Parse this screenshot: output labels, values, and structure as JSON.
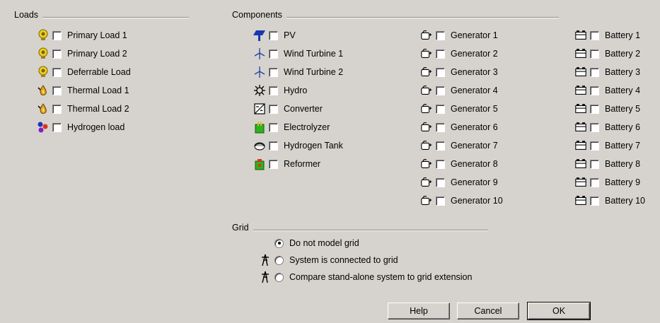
{
  "loads": {
    "title": "Loads",
    "items": [
      {
        "label": "Primary Load 1",
        "icon": "bulb-icon"
      },
      {
        "label": "Primary Load 2",
        "icon": "bulb-icon"
      },
      {
        "label": "Deferrable Load",
        "icon": "bulb-icon"
      },
      {
        "label": "Thermal Load 1",
        "icon": "flame-icon"
      },
      {
        "label": "Thermal Load 2",
        "icon": "flame-icon"
      },
      {
        "label": "Hydrogen load",
        "icon": "molecule-icon"
      }
    ]
  },
  "components": {
    "title": "Components",
    "col1": [
      {
        "label": "PV",
        "icon": "solar-panel-icon"
      },
      {
        "label": "Wind Turbine 1",
        "icon": "wind-turbine-icon"
      },
      {
        "label": "Wind Turbine 2",
        "icon": "wind-turbine-icon"
      },
      {
        "label": "Hydro",
        "icon": "hydro-turbine-icon"
      },
      {
        "label": "Converter",
        "icon": "converter-icon"
      },
      {
        "label": "Electrolyzer",
        "icon": "electrolyzer-icon"
      },
      {
        "label": "Hydrogen Tank",
        "icon": "hydrogen-tank-icon"
      },
      {
        "label": "Reformer",
        "icon": "reformer-icon"
      }
    ],
    "generators": [
      "Generator 1",
      "Generator 2",
      "Generator 3",
      "Generator 4",
      "Generator 5",
      "Generator 6",
      "Generator 7",
      "Generator 8",
      "Generator 9",
      "Generator 10"
    ],
    "batteries": [
      "Battery 1",
      "Battery 2",
      "Battery 3",
      "Battery 4",
      "Battery 5",
      "Battery 6",
      "Battery 7",
      "Battery 8",
      "Battery 9",
      "Battery 10"
    ]
  },
  "grid": {
    "title": "Grid",
    "options": [
      {
        "label": "Do not model grid",
        "selected": true,
        "icon": ""
      },
      {
        "label": "System is connected to grid",
        "selected": false,
        "icon": "grid-tower-icon"
      },
      {
        "label": "Compare stand-alone system to grid extension",
        "selected": false,
        "icon": "grid-tower-icon"
      }
    ]
  },
  "buttons": {
    "help": "Help",
    "cancel": "Cancel",
    "ok": "OK"
  }
}
